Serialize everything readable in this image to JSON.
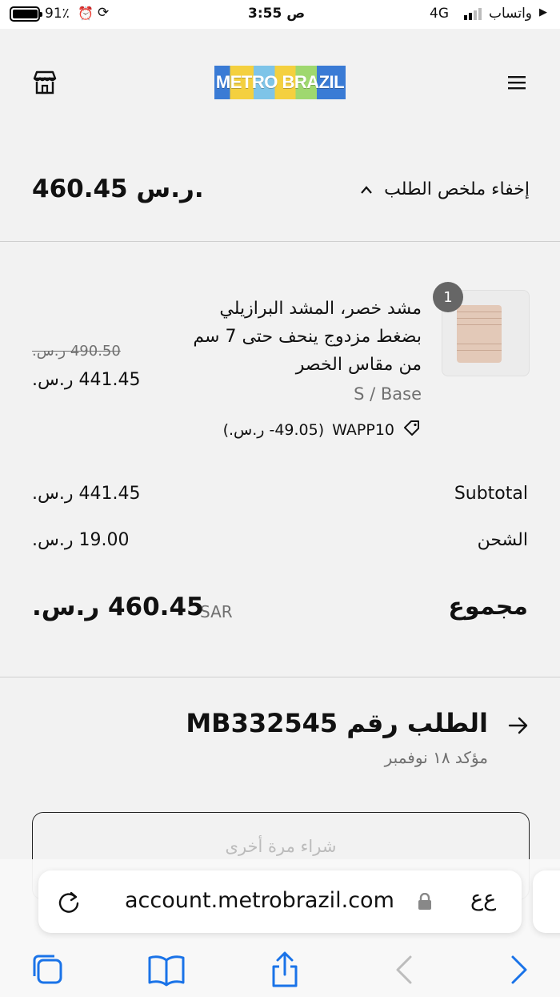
{
  "status_bar": {
    "battery": "91٪",
    "time": "3:55 ص",
    "network": "4G",
    "carrier": "واتساب"
  },
  "header": {
    "logo_text": "METRO BRAZIL",
    "menu_icon": "hamburger-icon",
    "store_icon": "store-icon"
  },
  "summary": {
    "toggle_label": "إخفاء ملخص الطلب",
    "total": "460.45 ر.س."
  },
  "product": {
    "quantity": "1",
    "title_line1": "مشد خصر، المشد البرازيلي",
    "title_line2": "بضغط مزدوج ينحف حتى 7 سم",
    "title_line3": "من مقاس الخصر",
    "variant": "S / Base",
    "discount_code": "WAPP10",
    "discount_amount": "(49.05- ر.س.)",
    "original_price": "490.50 ر.س.",
    "price": "441.45 ر.س."
  },
  "totals": {
    "subtotal_label": "Subtotal",
    "subtotal_value": "441.45 ر.س.",
    "shipping_label": "الشحن",
    "shipping_value": "19.00 ر.س.",
    "total_label": "مجموع",
    "currency": "SAR",
    "total_value": "460.45 ر.س."
  },
  "order": {
    "title": "الطلب رقم MB332545",
    "status": "مؤكد ١٨ نوفمبر",
    "buy_again_label": "شراء مرة أخرى"
  },
  "browser": {
    "aa_label": "ﻉﻉ",
    "url": "account.metrobrazil.com"
  },
  "colors": {
    "background": "#f2f2f2",
    "text": "#111111",
    "muted": "#707070",
    "badge": "#666666",
    "link_blue": "#1a73e8"
  }
}
